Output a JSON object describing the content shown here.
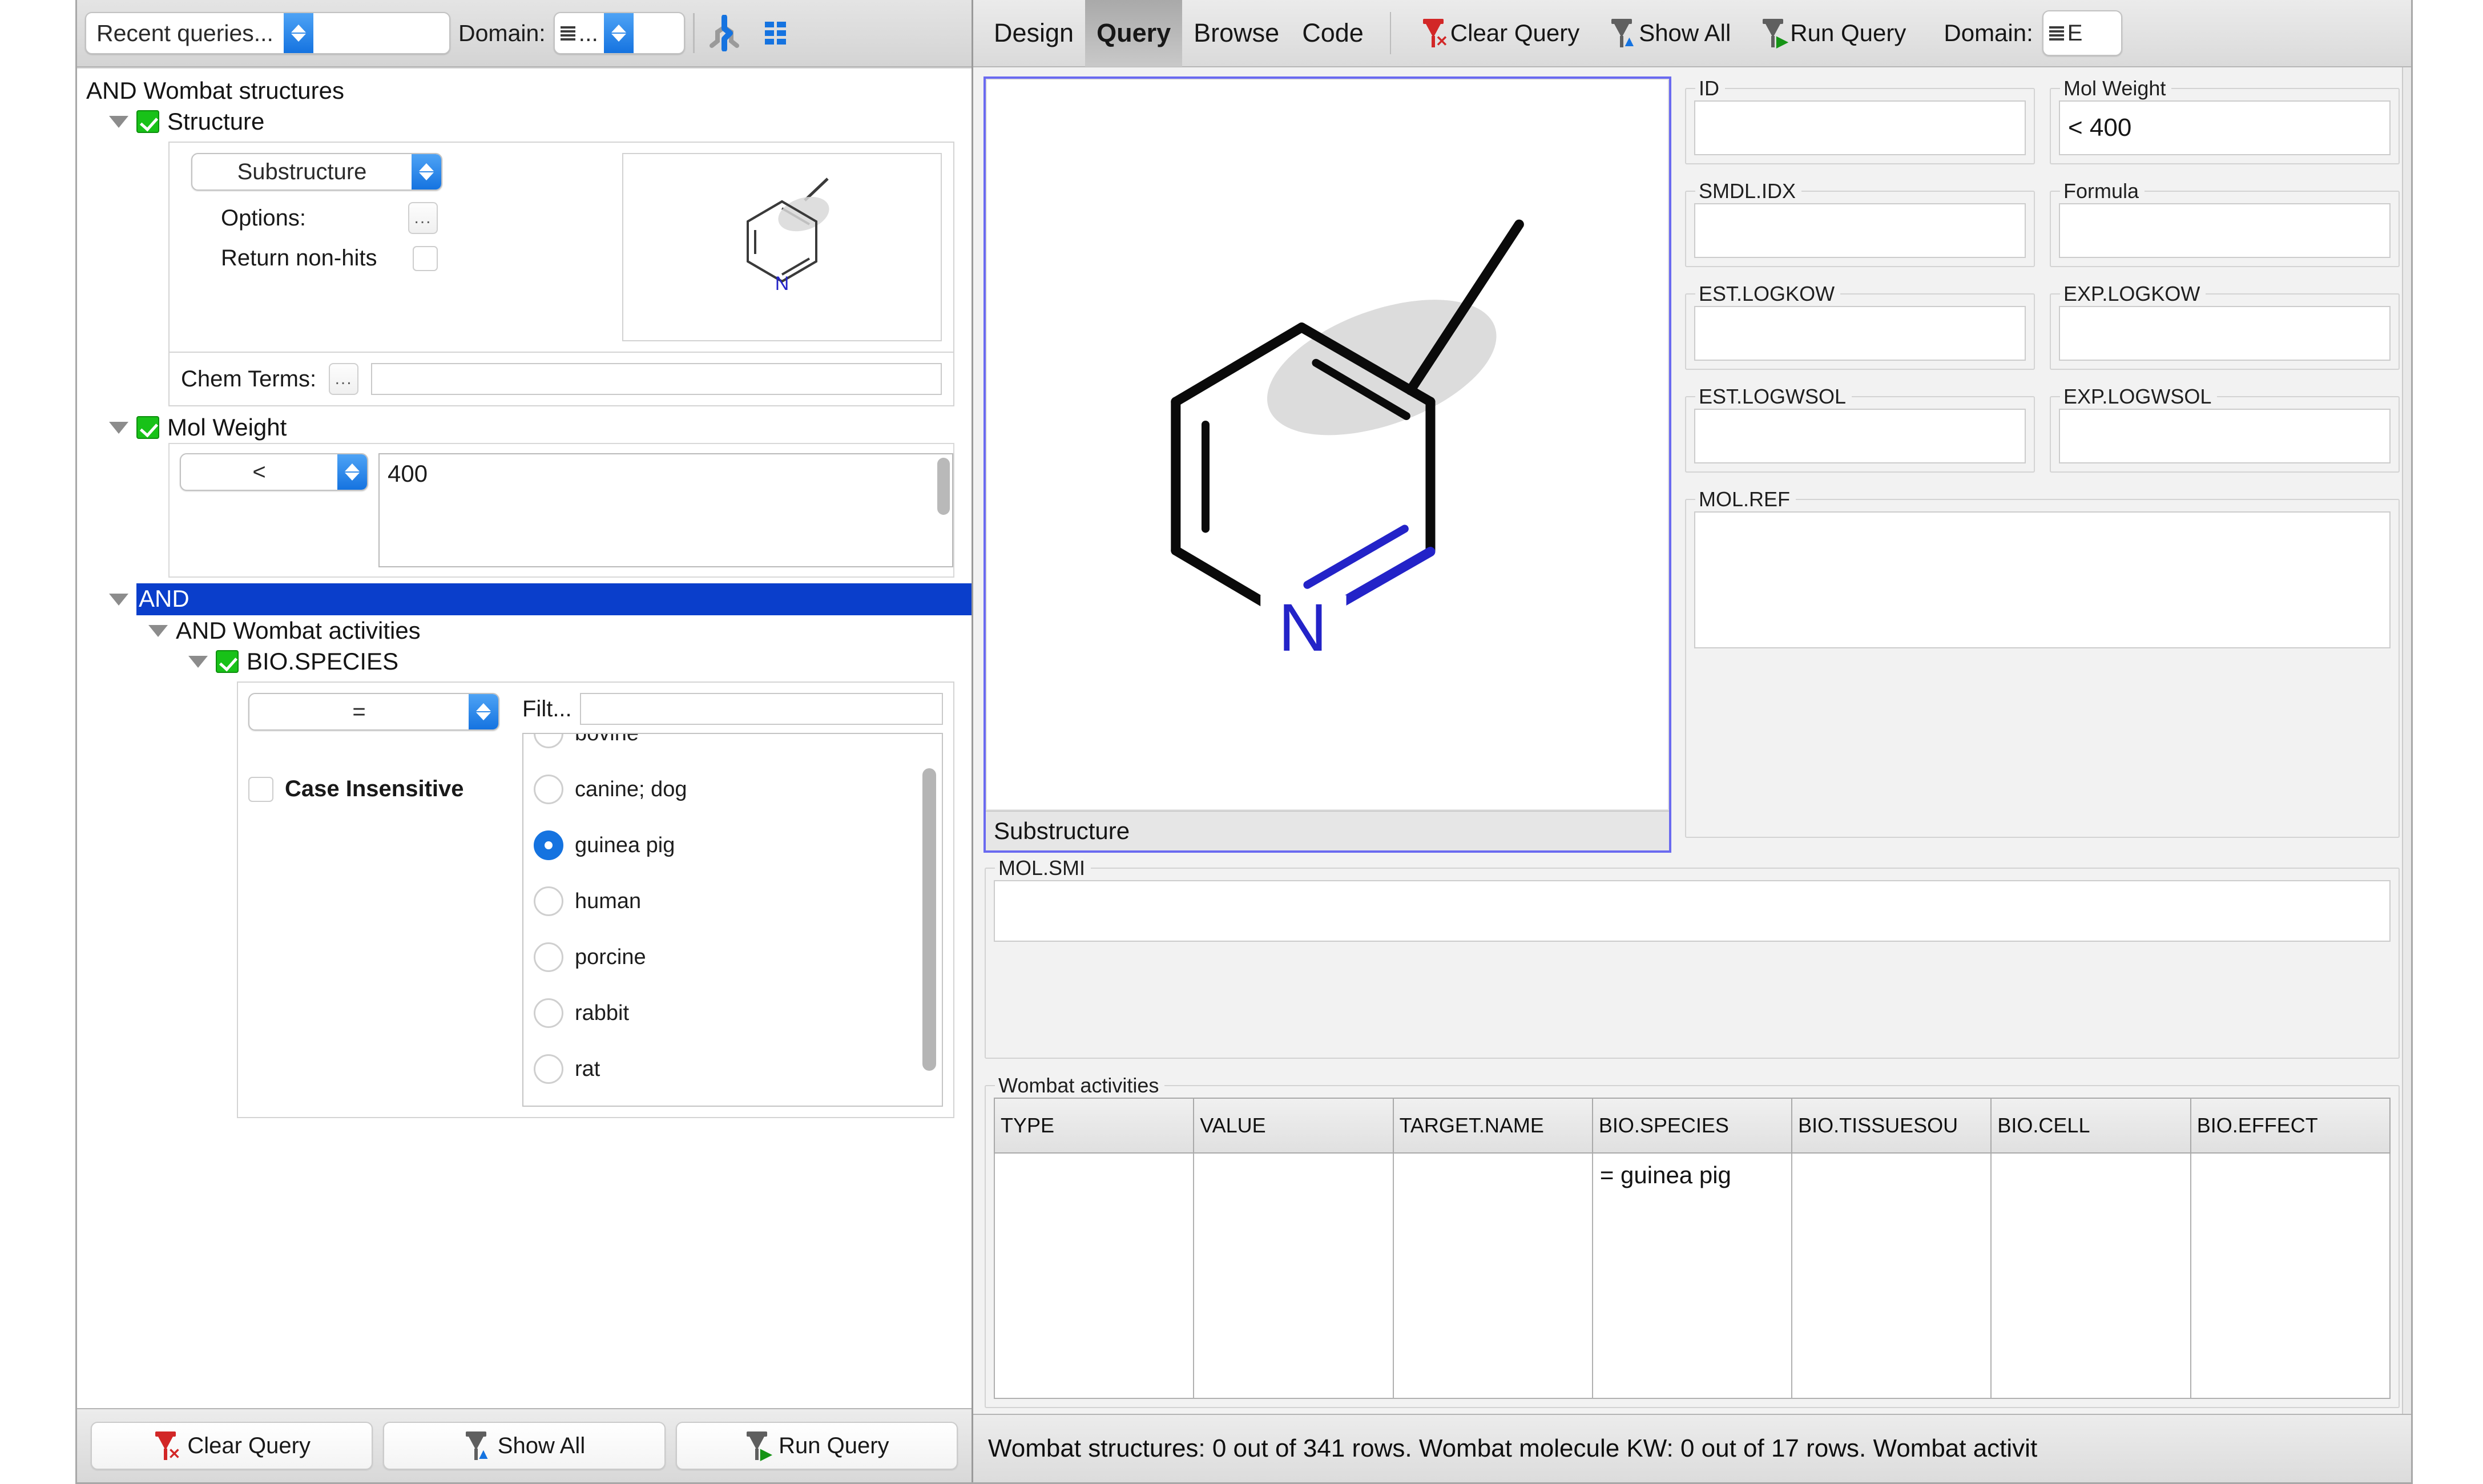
{
  "left_panel": {
    "toolbar": {
      "recent_queries_value": "Recent queries...",
      "domain_label": "Domain:",
      "domain_value": "...",
      "structure_icon_name": "structure-icon",
      "grid_icon_name": "grid-icon"
    },
    "tree": {
      "root_label": "AND Wombat structures",
      "structure_node": "Structure",
      "structure_mode": "Substructure",
      "options_label": "Options:",
      "return_nonhits_label": "Return non-hits",
      "chem_terms_label": "Chem Terms:",
      "chem_terms_value": "",
      "molweight_node": "Mol Weight",
      "molweight_operator": "<",
      "molweight_value": "400",
      "and_node": "AND",
      "and_activities_node": "AND Wombat activities",
      "bio_species_node": "BIO.SPECIES",
      "bio_species_operator": "=",
      "filter_label": "Filt...",
      "filter_value": "",
      "case_insensitive_label": "Case Insensitive",
      "species_options": [
        {
          "label": "bovine",
          "selected": false
        },
        {
          "label": "canine; dog",
          "selected": false
        },
        {
          "label": "guinea pig",
          "selected": true
        },
        {
          "label": "human",
          "selected": false
        },
        {
          "label": "porcine",
          "selected": false
        },
        {
          "label": "rabbit",
          "selected": false
        },
        {
          "label": "rat",
          "selected": false
        }
      ]
    },
    "buttons": {
      "clear_query": "Clear Query",
      "show_all": "Show All",
      "run_query": "Run Query"
    }
  },
  "right_panel": {
    "tabs": [
      {
        "label": "Design",
        "active": false
      },
      {
        "label": "Query",
        "active": true
      },
      {
        "label": "Browse",
        "active": false
      },
      {
        "label": "Code",
        "active": false
      }
    ],
    "actions": {
      "clear_query": "Clear Query",
      "show_all": "Show All",
      "run_query": "Run Query",
      "domain_label": "Domain:",
      "domain_value": "E"
    },
    "sketcher": {
      "status": "Substructure",
      "molecule": "pyridine with methyl substituent",
      "atom_label_n": "N"
    },
    "fields": [
      {
        "legend": "ID",
        "value": ""
      },
      {
        "legend": "Mol Weight",
        "value": "< 400"
      },
      {
        "legend": "SMDL.IDX",
        "value": ""
      },
      {
        "legend": "Formula",
        "value": ""
      },
      {
        "legend": "EST.LOGKOW",
        "value": ""
      },
      {
        "legend": "EXP.LOGKOW",
        "value": ""
      },
      {
        "legend": "EST.LOGWSOL",
        "value": ""
      },
      {
        "legend": "EXP.LOGWSOL",
        "value": ""
      }
    ],
    "mol_ref": {
      "legend": "MOL.REF",
      "value": ""
    },
    "mol_smi": {
      "legend": "MOL.SMI",
      "value": ""
    },
    "activities": {
      "legend": "Wombat activities",
      "columns": [
        "TYPE",
        "VALUE",
        "TARGET.NAME",
        "BIO.SPECIES",
        "BIO.TISSUESOU",
        "BIO.CELL",
        "BIO.EFFECT"
      ],
      "rows": [
        {
          "TYPE": "",
          "VALUE": "",
          "TARGET.NAME": "",
          "BIO.SPECIES": "= guinea pig",
          "BIO.TISSUESOU": "",
          "BIO.CELL": "",
          "BIO.EFFECT": ""
        }
      ]
    },
    "status_bar": "Wombat structures: 0 out of 341 rows. Wombat molecule KW: 0 out of 17 rows. Wombat activit"
  },
  "colors": {
    "accent_blue": "#1573e0",
    "selection_blue": "#0a3ecb",
    "check_green": "#18c218",
    "clear_red": "#d22727",
    "run_green": "#169416",
    "nitrogen_blue": "#2323c8",
    "sketcher_border": "#6a6af0",
    "highlight_gray": "#dcdcdc"
  }
}
